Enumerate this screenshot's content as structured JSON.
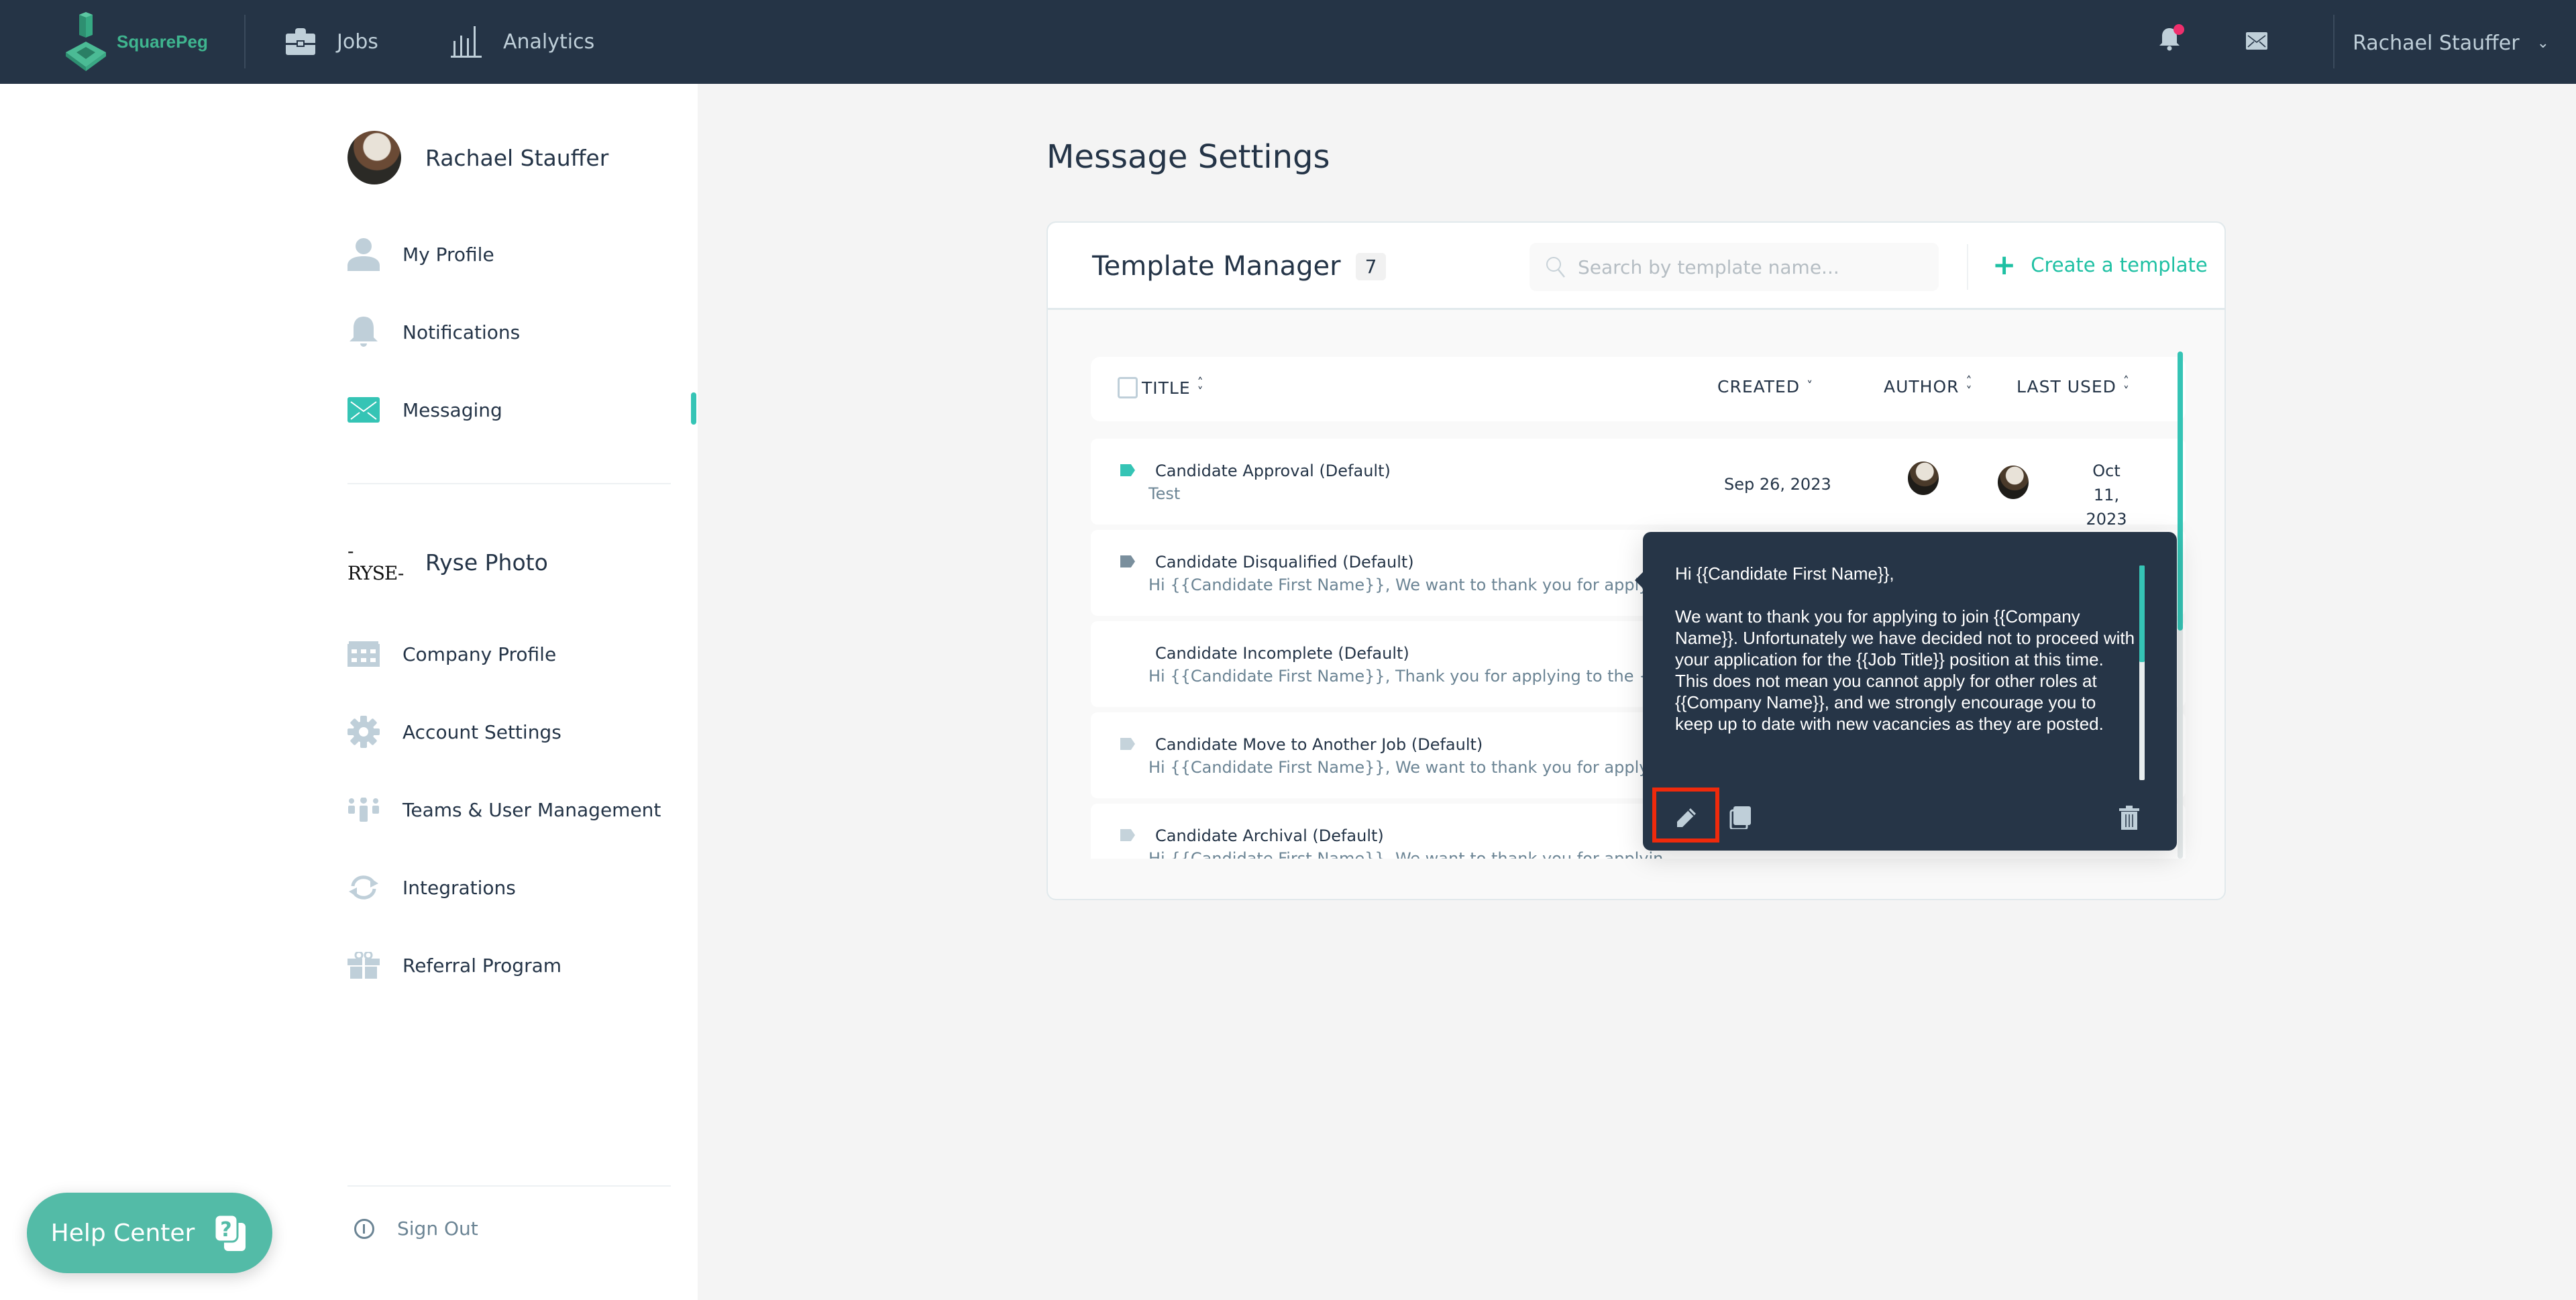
{
  "topbar": {
    "brand": "SquarePeg",
    "nav": [
      {
        "label": "Jobs",
        "icon": "briefcase-icon"
      },
      {
        "label": "Analytics",
        "icon": "bar-chart-icon"
      }
    ],
    "notification_badge": true,
    "user_name": "Rachael Stauffer"
  },
  "sidebar": {
    "profile_name": "Rachael Stauffer",
    "personal_items": [
      {
        "label": "My Profile",
        "icon": "user-icon",
        "active": false
      },
      {
        "label": "Notifications",
        "icon": "bell-icon",
        "active": false
      },
      {
        "label": "Messaging",
        "icon": "envelope-icon",
        "active": true
      }
    ],
    "company_logo_text": "-RYSE-",
    "company_name": "Ryse Photo",
    "company_items": [
      {
        "label": "Company Profile",
        "icon": "building-icon"
      },
      {
        "label": "Account Settings",
        "icon": "gear-icon"
      },
      {
        "label": "Teams & User Management",
        "icon": "team-icon"
      },
      {
        "label": "Integrations",
        "icon": "sync-icon"
      },
      {
        "label": "Referral Program",
        "icon": "gift-icon"
      }
    ],
    "sign_out": "Sign Out"
  },
  "help_center": {
    "label": "Help Center"
  },
  "main": {
    "page_title": "Message Settings",
    "template_manager": {
      "title": "Template Manager",
      "count": "7",
      "search_placeholder": "Search by template name...",
      "search_value": "",
      "create_label": "Create a template"
    },
    "table": {
      "columns": {
        "title": "TITLE",
        "created": "CREATED",
        "author": "AUTHOR",
        "last_used": "LAST USED"
      },
      "scroll_fraction": 0.55,
      "rows": [
        {
          "title": "Candidate Approval (Default)",
          "preview": "Test",
          "tag_color": "#35c4b5",
          "created": "Sep 26, 2023",
          "last_used": "Oct 11, 2023",
          "has_author": true
        },
        {
          "title": "Candidate Disqualified (Default)",
          "preview": "Hi {{Candidate First Name}}, We want to thank you for applying to join...",
          "tag_color": "#7a8f9d",
          "created": "",
          "last_used": "",
          "has_author": false
        },
        {
          "title": "Candidate Incomplete (Default)",
          "preview": "Hi {{Candidate First Name}}, Thank you for applying to the {{Job Title}}...",
          "tag_color": "",
          "created": "",
          "last_used": "",
          "has_author": false
        },
        {
          "title": "Candidate Move to Another Job (Default)",
          "preview": "Hi {{Candidate First Name}}, We want to thank you for applying to join...",
          "tag_color": "#c5d3db",
          "created": "",
          "last_used": "",
          "has_author": false
        },
        {
          "title": "Candidate Archival (Default)",
          "preview": "Hi {{Candidate First Name}}, We want to thank you for applying to join...",
          "tag_color": "#c5d3db",
          "created": "",
          "last_used": "",
          "has_author": false
        }
      ]
    }
  },
  "popover": {
    "body": "Hi {{Candidate First Name}},\n\nWe want to thank you for applying to join {{Company Name}}. Unfortunately we have decided not to proceed with your application for the {{Job Title}} position at this time. This does not mean you cannot apply for other roles at {{Company Name}}, and we strongly encourage you to keep up to date with new vacancies as they are posted.",
    "scroll_fraction": 0.45,
    "actions": [
      {
        "name": "edit",
        "icon": "pencil-icon",
        "highlighted": true
      },
      {
        "name": "duplicate",
        "icon": "copy-icon"
      },
      {
        "name": "delete",
        "icon": "trash-icon"
      }
    ]
  },
  "colors": {
    "header_bg": "#253446",
    "accent": "#35c4b5",
    "create_link": "#1ec0a3",
    "help_button": "#53bba7",
    "notification_dot": "#ef2f6d",
    "highlight_box": "#ef2a0c"
  }
}
